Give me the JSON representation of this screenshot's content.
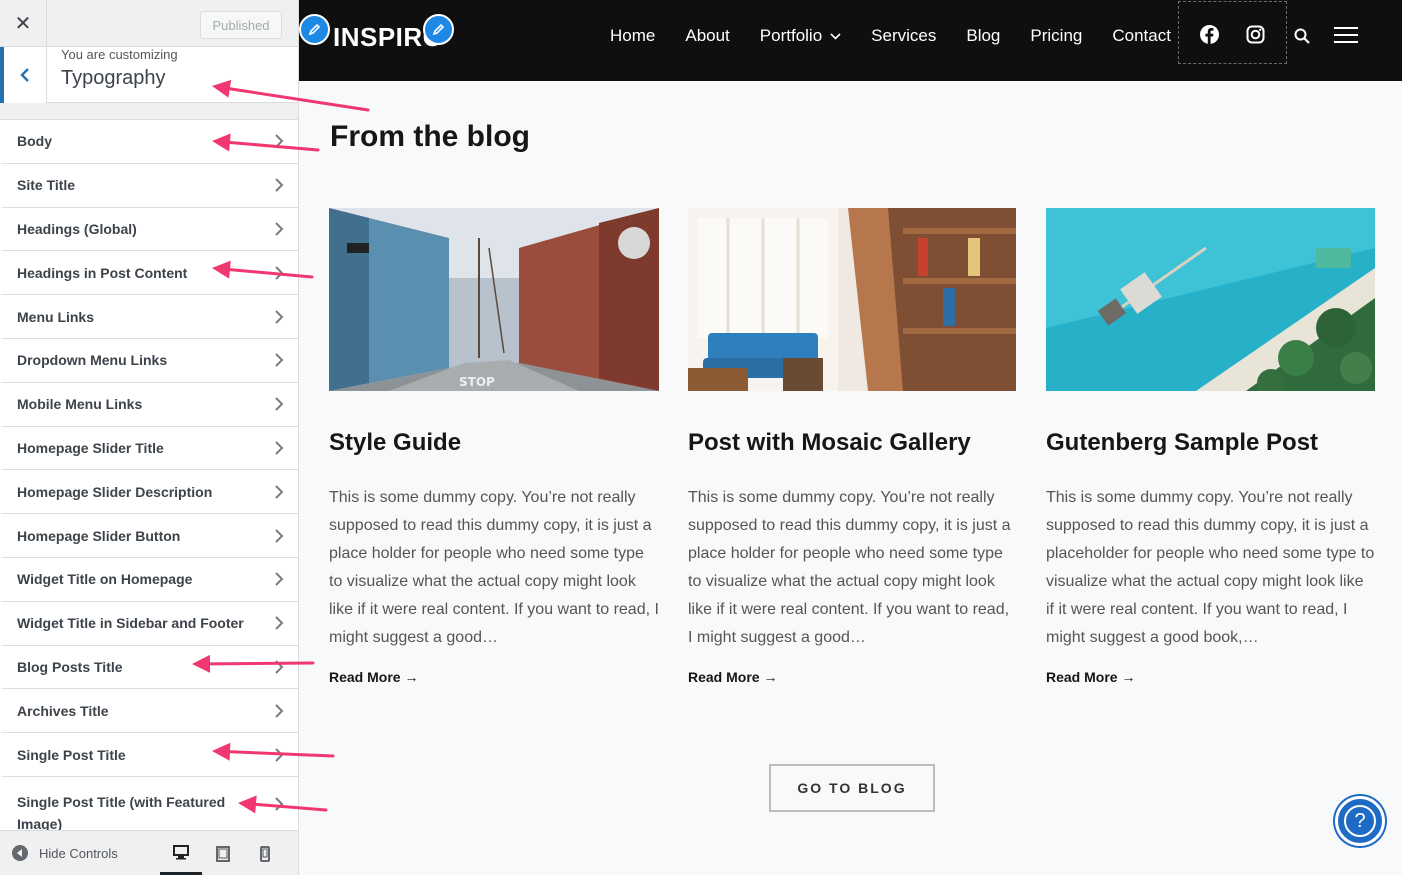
{
  "customizer": {
    "close_glyph": "✕",
    "published_label": "Published",
    "back_glyph": "‹",
    "customizing_label": "You are customizing",
    "section_title": "Typography",
    "items": [
      {
        "label": "Body"
      },
      {
        "label": "Site Title"
      },
      {
        "label": "Headings (Global)"
      },
      {
        "label": "Headings in Post Content"
      },
      {
        "label": "Menu Links"
      },
      {
        "label": "Dropdown Menu Links"
      },
      {
        "label": "Mobile Menu Links"
      },
      {
        "label": "Homepage Slider Title"
      },
      {
        "label": "Homepage Slider Description"
      },
      {
        "label": "Homepage Slider Button"
      },
      {
        "label": "Widget Title on Homepage"
      },
      {
        "label": "Widget Title in Sidebar and Footer"
      },
      {
        "label": "Blog Posts Title"
      },
      {
        "label": "Archives Title"
      },
      {
        "label": "Single Post Title"
      },
      {
        "label": "Single Post Title (with Featured Image)"
      }
    ],
    "hide_controls_label": "Hide Controls",
    "devices": [
      "desktop-icon",
      "tablet-icon",
      "mobile-icon"
    ],
    "accent": "#2271b1"
  },
  "site": {
    "logo": "INSPIRO",
    "nav": [
      "Home",
      "About",
      "Portfolio",
      "Services",
      "Blog",
      "Pricing",
      "Contact"
    ],
    "social": [
      "facebook-icon",
      "instagram-icon"
    ],
    "blog_heading": "From the blog",
    "posts": [
      {
        "title": "Style Guide",
        "excerpt": "This is some dummy copy. You’re not really supposed to read this dummy copy, it is just a place holder for people who need some type to visualize what the actual copy might look like if it were real content. If you want to read, I might suggest a good…",
        "read_more": "Read More →",
        "image": "street-photo"
      },
      {
        "title": "Post with Mosaic Gallery",
        "excerpt": "This is some dummy copy. You’re not really supposed to read this dummy copy, it is just a place holder for people who need some type to visualize what the actual copy might look like if it were real content. If you want to read, I might suggest a good…",
        "read_more": "Read More →",
        "image": "library-photo"
      },
      {
        "title": "Gutenberg Sample Post",
        "excerpt": "This is some dummy copy. You’re not really supposed to read this dummy copy, it is just a placeholder for people who need some type to visualize what the actual copy might look like if it were real content. If you want to read, I might suggest a good book,…",
        "read_more": "Read More →",
        "image": "beach-aerial-photo"
      }
    ],
    "go_to_blog": "GO TO BLOG",
    "help_glyph": "?",
    "highlight_color": "#f0376f"
  }
}
